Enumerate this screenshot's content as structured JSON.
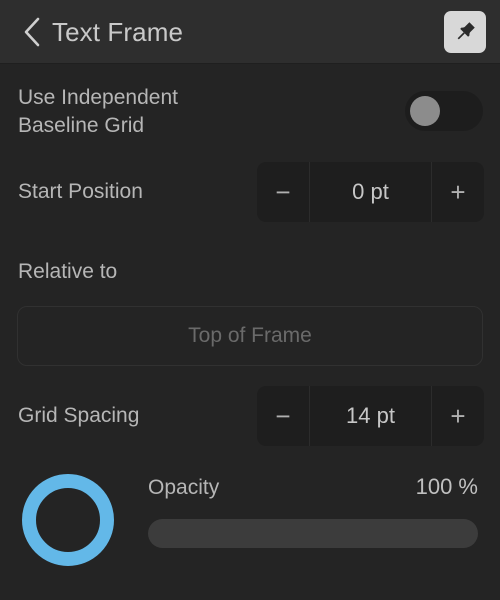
{
  "header": {
    "back_icon": "chevron-left-icon",
    "title": "Text Frame",
    "pin_icon": "pushpin-icon"
  },
  "colors": {
    "panel_bg": "#242424",
    "header_bg": "#2e2e2e",
    "accent_ring": "#63b8e8",
    "label_text": "#b6b6b6",
    "dim_text": "#6a6a6a"
  },
  "settings": {
    "independent_baseline_grid": {
      "label": "Use Independent\nBaseline Grid",
      "toggle_state": "off"
    },
    "start_position": {
      "label": "Start Position",
      "decrement_label": "−",
      "value": "0 pt",
      "increment_label": "+"
    },
    "relative_to": {
      "label": "Relative to",
      "value": "Top of Frame"
    },
    "grid_spacing": {
      "label": "Grid Spacing",
      "decrement_label": "−",
      "value": "14 pt",
      "increment_label": "+"
    },
    "opacity": {
      "label": "Opacity",
      "value": "100 %",
      "swatch_color": "#63b8e8"
    }
  }
}
